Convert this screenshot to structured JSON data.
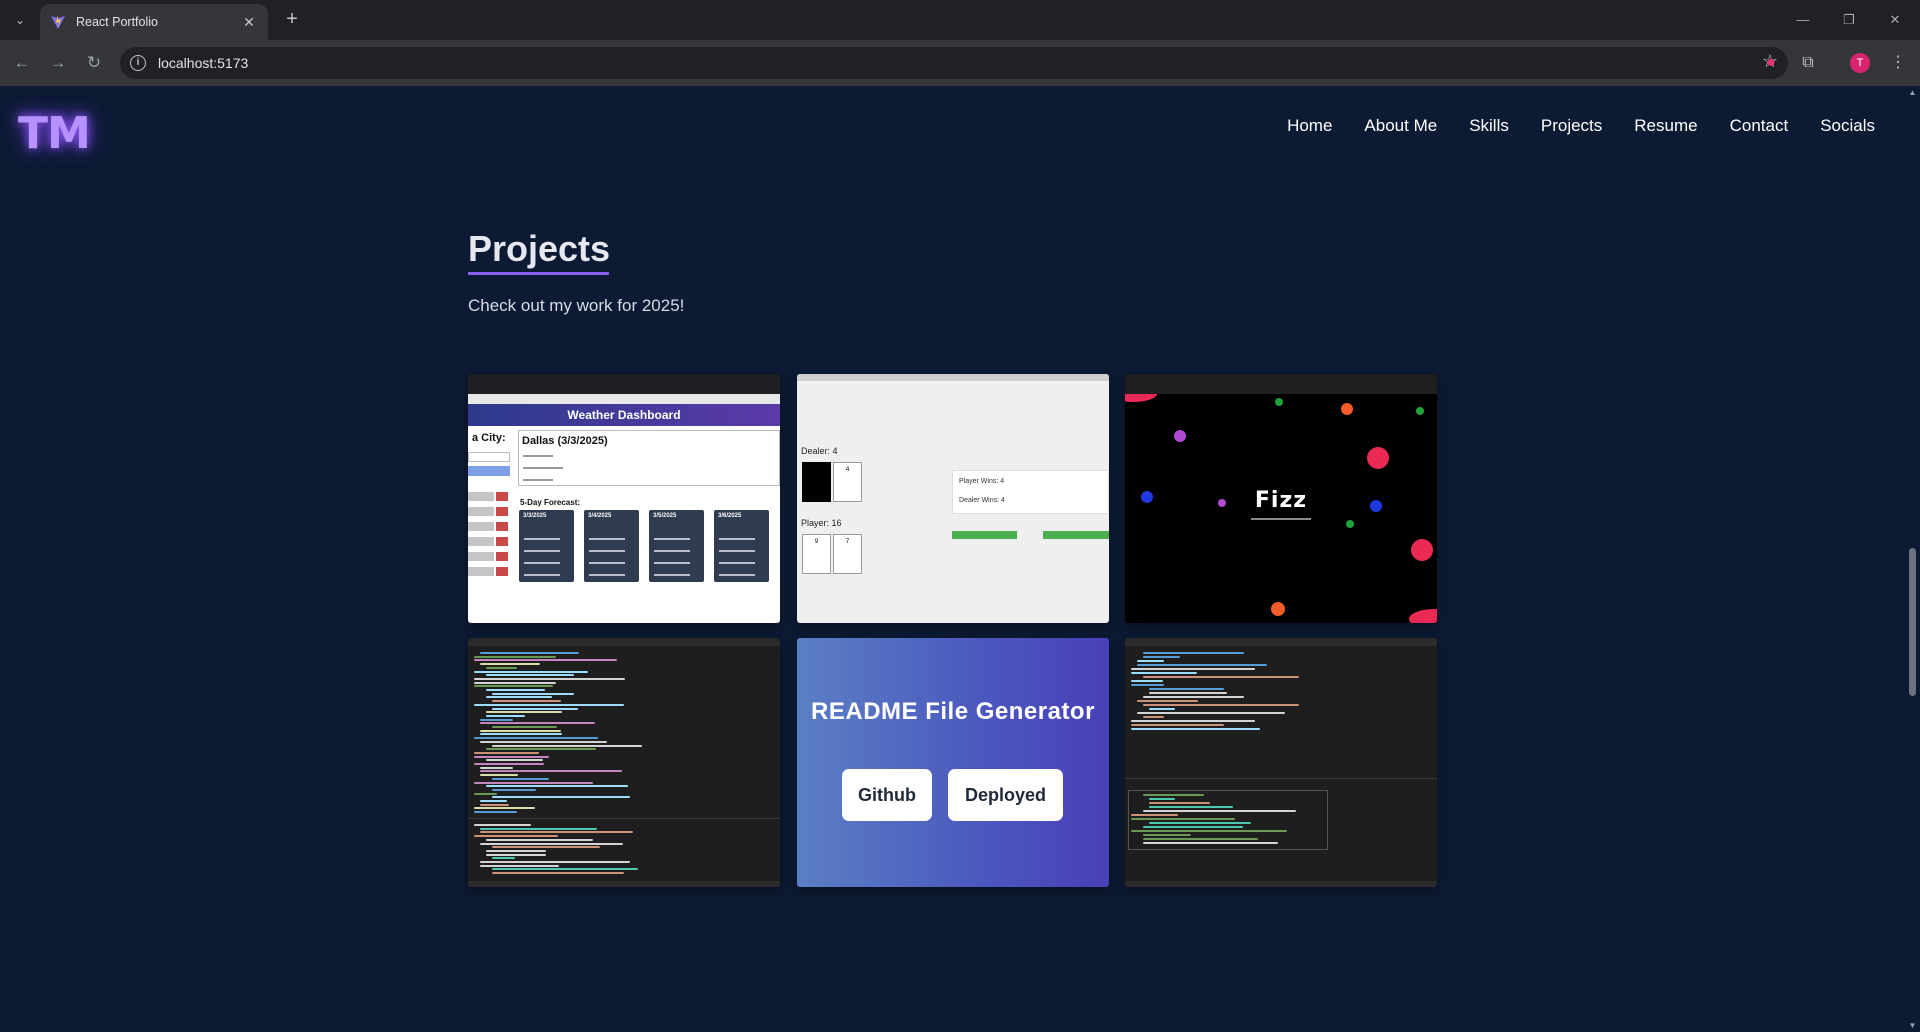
{
  "browser": {
    "tab_title": "React Portfolio",
    "url": "localhost:5173",
    "avatar_letter": "T"
  },
  "site": {
    "logo": "TM",
    "nav": [
      "Home",
      "About Me",
      "Skills",
      "Projects",
      "Resume",
      "Contact",
      "Socials"
    ]
  },
  "projects": {
    "title": "Projects",
    "subtitle": "Check out my work for 2025!",
    "weather": {
      "header": "Weather Dashboard",
      "search_label": "a City:",
      "current": "Dallas (3/3/2025)",
      "forecast_label": "5-Day Forecast:",
      "days": [
        "3/3/2025",
        "3/4/2025",
        "3/5/2025",
        "3/6/2025"
      ]
    },
    "blackjack": {
      "dealer": "Dealer: 4",
      "dealer_card": "4",
      "player": "Player: 16",
      "player_cards": [
        "9",
        "7"
      ],
      "player_wins": "Player Wins: 4",
      "dealer_wins": "Dealer Wins: 4"
    },
    "fizz": {
      "logo": "Fizz"
    },
    "readme": {
      "title": "README File Generator",
      "github": "Github",
      "deployed": "Deployed"
    }
  },
  "colors": {
    "page_bg": "#0c1a33",
    "accent": "#8b5cf6",
    "logo": "#b592ff"
  }
}
